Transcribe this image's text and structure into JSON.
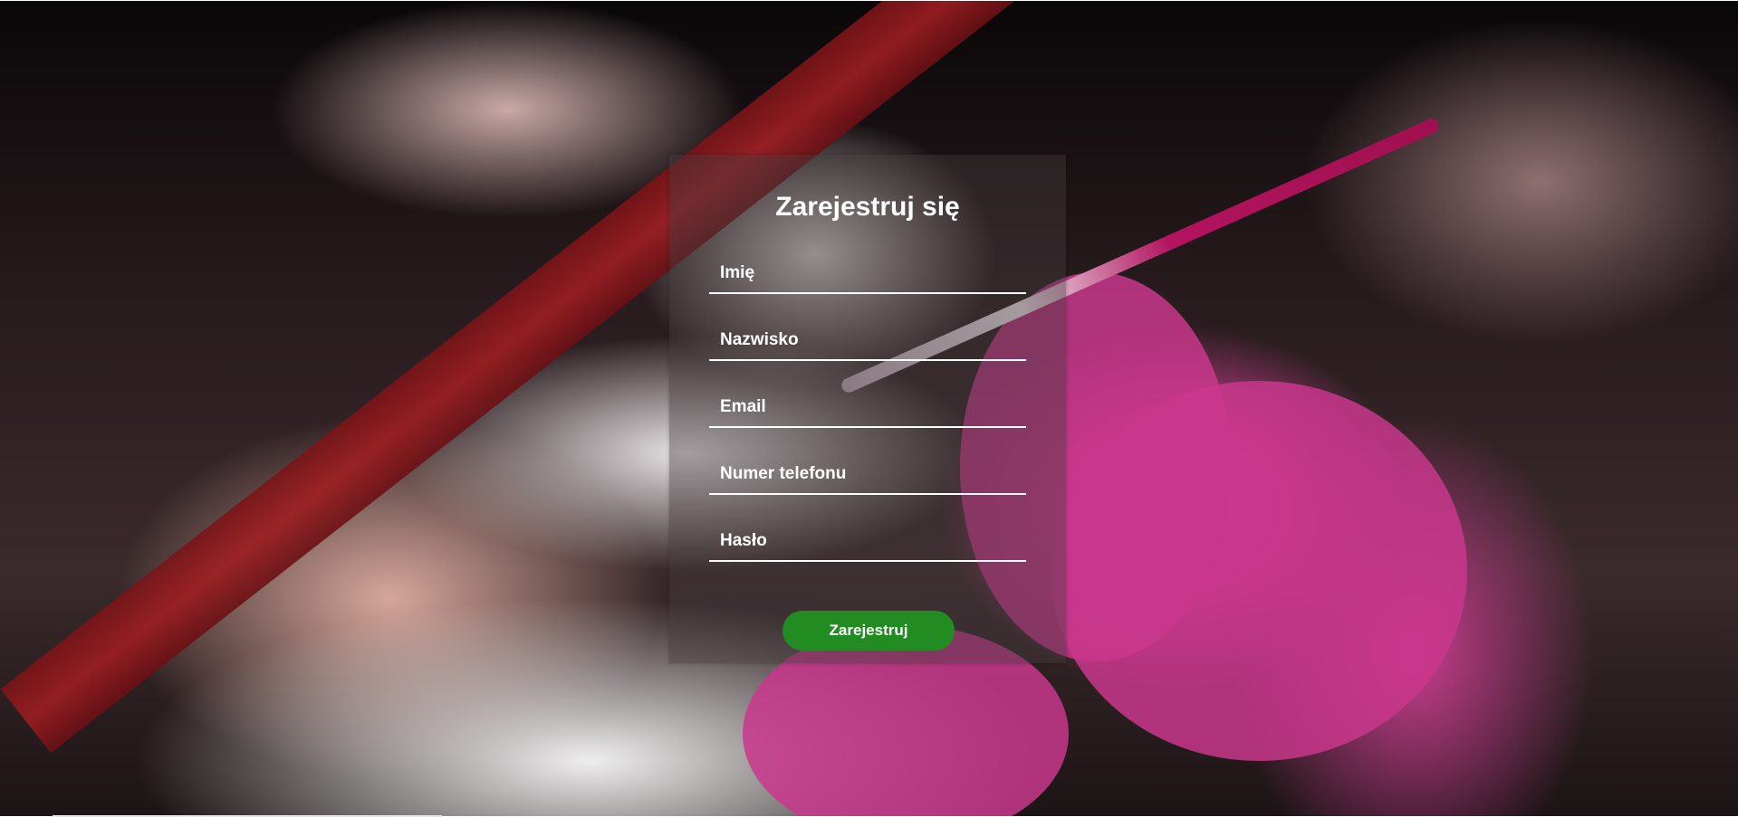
{
  "form": {
    "title": "Zarejestruj się",
    "fields": [
      {
        "name": "first-name",
        "placeholder": "Imię",
        "value": ""
      },
      {
        "name": "last-name",
        "placeholder": "Nazwisko",
        "value": ""
      },
      {
        "name": "email",
        "placeholder": "Email",
        "value": ""
      },
      {
        "name": "phone",
        "placeholder": "Numer telefonu",
        "value": ""
      },
      {
        "name": "password",
        "placeholder": "Hasło",
        "value": ""
      }
    ],
    "submit_label": "Zarejestruj"
  },
  "colors": {
    "submit_button": "#228b22",
    "text": "#ffffff",
    "panel_overlay": "rgba(70, 60, 62, 0.42)"
  },
  "background": {
    "description_icon": "manicure-photo"
  }
}
